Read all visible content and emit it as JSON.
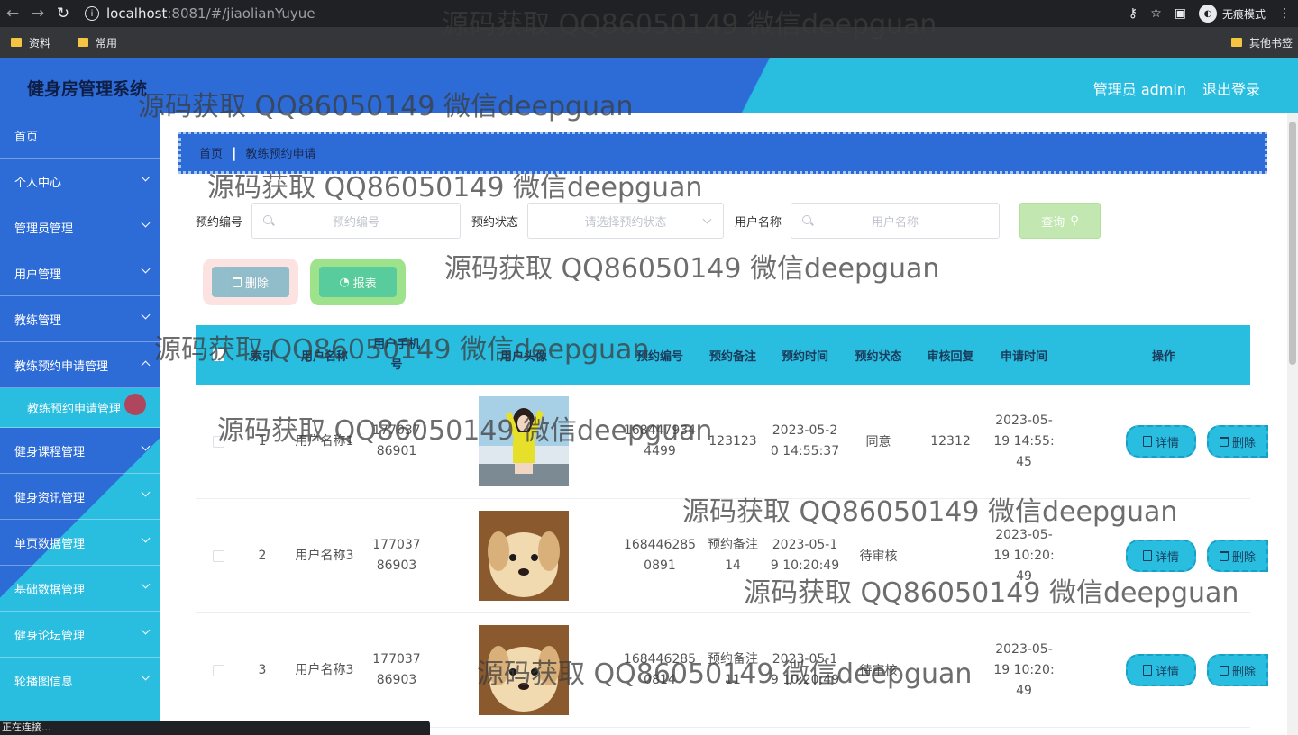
{
  "browser": {
    "url_host": "localhost",
    "url_rest": ":8081/#/jiaolianYuyue",
    "incognito_label": "无痕模式",
    "bookmarks": [
      "资料",
      "常用"
    ],
    "other_bookmarks": "其他书签",
    "status_text": "正在连接..."
  },
  "header": {
    "title": "健身房管理系统",
    "user": "管理员 admin",
    "logout": "退出登录"
  },
  "sidebar": {
    "items": [
      {
        "label": "首页"
      },
      {
        "label": "个人中心"
      },
      {
        "label": "管理员管理"
      },
      {
        "label": "用户管理"
      },
      {
        "label": "教练管理"
      },
      {
        "label": "教练预约申请管理"
      },
      {
        "label": "教练预约申请管理"
      },
      {
        "label": "健身课程管理"
      },
      {
        "label": "健身资讯管理"
      },
      {
        "label": "单页数据管理"
      },
      {
        "label": "基础数据管理"
      },
      {
        "label": "健身论坛管理"
      },
      {
        "label": "轮播图信息"
      }
    ]
  },
  "breadcrumb": {
    "home": "首页",
    "sep": "|",
    "current": "教练预约申请"
  },
  "search": {
    "label1": "预约编号",
    "placeholder1": "预约编号",
    "label2": "预约状态",
    "placeholder2": "请选择预约状态",
    "label3": "用户名称",
    "placeholder3": "用户名称",
    "query": "查询"
  },
  "actions": {
    "delete": "删除",
    "report": "报表"
  },
  "table": {
    "headers": [
      "索引",
      "用户名称",
      "用户手机号",
      "用户头像",
      "预约编号",
      "预约备注",
      "预约时间",
      "预约状态",
      "审核回复",
      "申请时间",
      "操作"
    ],
    "detail_label": "详情",
    "delete_label": "删除",
    "rows": [
      {
        "index": "1",
        "name": "用户名称1",
        "phone": "17703786901",
        "code": "1684479344499",
        "note": "123123",
        "time": "2023-05-20 14:55:37",
        "status": "同意",
        "reply": "12312",
        "apply": "2023-05-19 14:55:45",
        "avatar": "girl-photo"
      },
      {
        "index": "2",
        "name": "用户名称3",
        "phone": "17703786903",
        "code": "1684462850891",
        "note": "预约备注14",
        "time": "2023-05-19 10:20:49",
        "status": "待审核",
        "reply": "",
        "apply": "2023-05-19 10:20:49",
        "avatar": "puppy-photo"
      },
      {
        "index": "3",
        "name": "用户名称3",
        "phone": "17703786903",
        "code": "1684462850814",
        "note": "预约备注11",
        "time": "2023-05-19 10:20:49",
        "status": "待审核",
        "reply": "",
        "apply": "2023-05-19 10:20:49",
        "avatar": "puppy-photo"
      }
    ]
  },
  "watermark": "源码获取 QQ86050149 微信deepguan",
  "colors": {
    "primary": "#2d6bd6",
    "accent": "#29bde0",
    "query": "#c2e7b0"
  }
}
